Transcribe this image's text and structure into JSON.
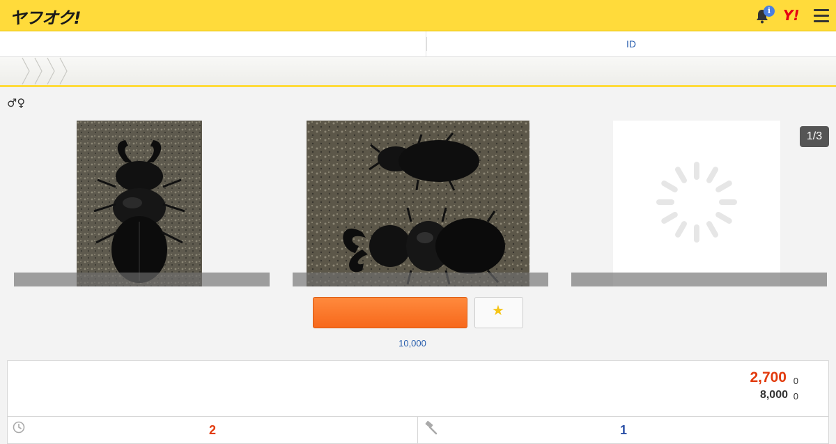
{
  "header": {
    "logo_text": "ヤフオク!",
    "notification_badge": "i",
    "yahoo_mark": "Y!",
    "icons": [
      "bell-icon",
      "menu-icon"
    ]
  },
  "tabs": {
    "left_label": "",
    "right_label": "ID"
  },
  "item": {
    "title": "♂♀"
  },
  "gallery": {
    "counter": "1/3",
    "images": [
      "stag-beetle-male-top",
      "stag-beetle-pair",
      "loading"
    ]
  },
  "actions": {
    "watch_count": "10,000"
  },
  "price": {
    "current": "2,700",
    "current_sub": "0",
    "buyout": "8,000",
    "buyout_sub": "0",
    "time_left": "2",
    "bid_count": "1"
  },
  "colors": {
    "header_bg": "#ffdb3b",
    "accent_orange": "#f7681b",
    "price_red": "#e23b0e",
    "link_blue": "#2a5fae"
  }
}
